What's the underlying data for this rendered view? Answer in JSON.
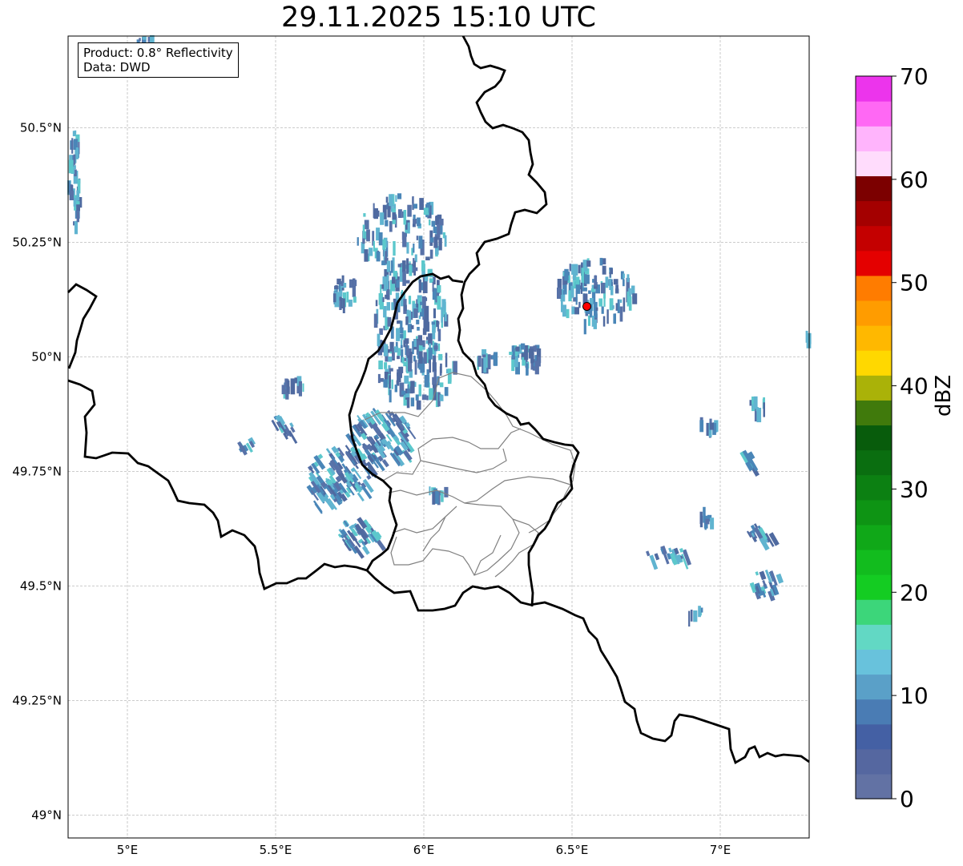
{
  "title": "29.11.2025 15:10 UTC",
  "info": {
    "product": "Product: 0.8° Reflectivity",
    "data": "Data: DWD"
  },
  "map": {
    "lon_range": [
      4.8,
      7.3
    ],
    "lat_range": [
      48.95,
      50.7
    ],
    "lon_ticks": [
      {
        "value": 5.0,
        "label": "5°E"
      },
      {
        "value": 5.5,
        "label": "5.5°E"
      },
      {
        "value": 6.0,
        "label": "6°E"
      },
      {
        "value": 6.5,
        "label": "6.5°E"
      },
      {
        "value": 7.0,
        "label": "7°E"
      }
    ],
    "lat_ticks": [
      {
        "value": 49.0,
        "label": "49°N"
      },
      {
        "value": 49.25,
        "label": "49.25°N"
      },
      {
        "value": 49.5,
        "label": "49.5°N"
      },
      {
        "value": 49.75,
        "label": "49.75°N"
      },
      {
        "value": 50.0,
        "label": "50°N"
      },
      {
        "value": 50.25,
        "label": "50.25°N"
      },
      {
        "value": 50.5,
        "label": "50.5°N"
      }
    ],
    "grid": true,
    "radar_site": {
      "lon": 6.55,
      "lat": 50.11,
      "color": "#ff0000"
    }
  },
  "colorbar": {
    "label": "dBZ",
    "range": [
      0,
      70
    ],
    "tick_labels": [
      "0",
      "10",
      "20",
      "30",
      "40",
      "50",
      "60",
      "70"
    ],
    "tick_values": [
      0,
      10,
      20,
      30,
      40,
      50,
      60,
      70
    ],
    "colors": [
      "#6272a4",
      "#5567a0",
      "#4460a4",
      "#4a7cb4",
      "#5aa0c8",
      "#68c2dc",
      "#62d8c4",
      "#3cd67a",
      "#14cc22",
      "#12bc1e",
      "#10a818",
      "#0e9414",
      "#0c8012",
      "#0a6e10",
      "#085c0c",
      "#407a0c",
      "#aab208",
      "#ffd800",
      "#ffb800",
      "#ff9c00",
      "#ff7c00",
      "#e40000",
      "#c40000",
      "#a40000",
      "#7c0000",
      "#ffdcfc",
      "#ffb4fc",
      "#ff68f4",
      "#ec34ec"
    ]
  },
  "echo_colors": [
    "#5872a8",
    "#4a86b8",
    "#60b4d0",
    "#5cc8cc",
    "#4f6aa0"
  ],
  "border_color": "#000000",
  "region_color": "#808080"
}
